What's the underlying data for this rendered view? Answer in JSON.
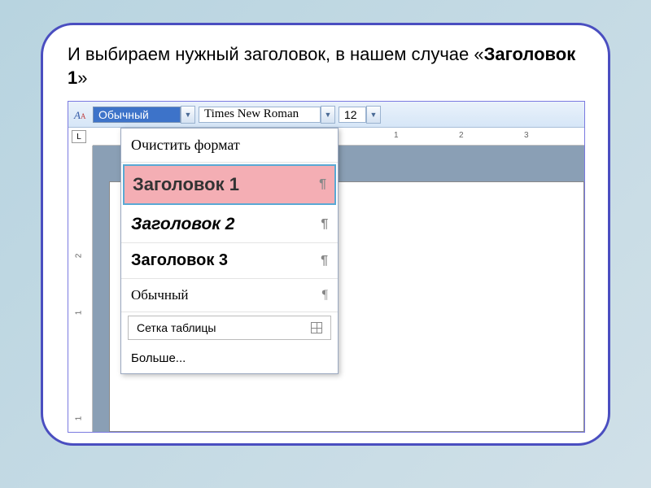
{
  "instruction": {
    "prefix": "    И выбираем нужный заголовок, в нашем случае «",
    "bold": "Заголовок 1",
    "suffix": "»"
  },
  "toolbar": {
    "style_value": "Обычный",
    "font_value": "Times New Roman",
    "size_value": "12"
  },
  "ruler": {
    "h": [
      "1",
      "2",
      "3"
    ],
    "v": [
      "1",
      "2",
      "1"
    ]
  },
  "dropdown": {
    "clear": "Очистить формат",
    "h1": "Заголовок 1",
    "h2": "Заголовок 2",
    "h3": "Заголовок 3",
    "normal": "Обычный",
    "tablegrid": "Сетка таблицы",
    "more": "Больше..."
  },
  "glyph": {
    "pilcrow": "¶",
    "arrow": "▼",
    "tab": "L"
  }
}
